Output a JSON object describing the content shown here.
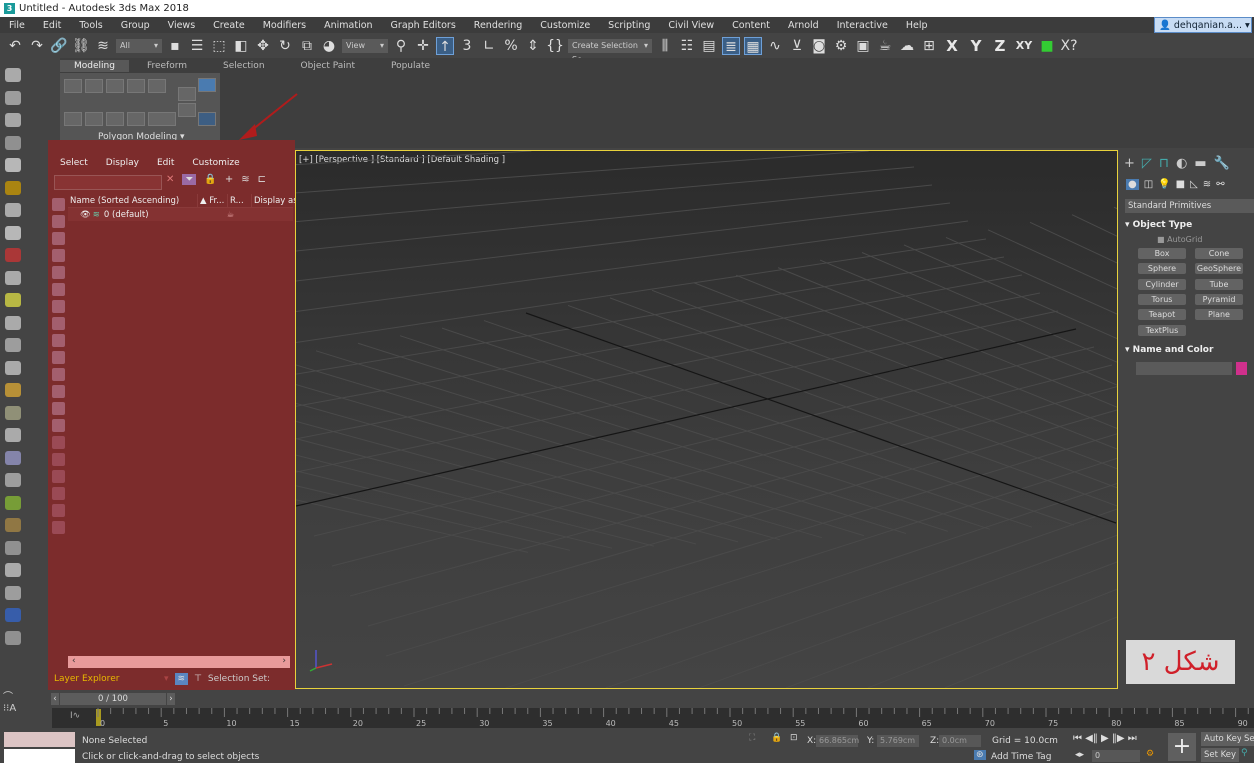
{
  "window": {
    "title": "Untitled - Autodesk 3ds Max 2018",
    "app_icon": "3"
  },
  "menu": [
    "File",
    "Edit",
    "Tools",
    "Group",
    "Views",
    "Create",
    "Modifiers",
    "Animation",
    "Graph Editors",
    "Rendering",
    "Customize",
    "Scripting",
    "Civil View",
    "Content",
    "Arnold",
    "Interactive",
    "Help"
  ],
  "user": {
    "name": "dehqanian.a...",
    "icon": "user-icon"
  },
  "toolbar": {
    "filter": "All",
    "coord": "View",
    "selection_set": "Create Selection Se",
    "axes": [
      "X",
      "Y",
      "Z",
      "XY"
    ]
  },
  "ribbon": {
    "tabs": [
      "Modeling",
      "Freeform",
      "Selection",
      "Object Paint",
      "Populate"
    ],
    "active": "Modeling",
    "panel_label": "Polygon Modeling"
  },
  "explorer": {
    "menu": [
      "Select",
      "Display",
      "Edit",
      "Customize"
    ],
    "columns": [
      "Name (Sorted Ascending)",
      "▲ Fr...",
      "R...",
      "Display as"
    ],
    "rows": [
      {
        "name": "0 (default)"
      }
    ],
    "mode": "Layer Explorer",
    "selection_set": "Selection Set:",
    "overlay_color": "#7c2c2c"
  },
  "viewport": {
    "label": "[+] [Perspective ] [Standard ] [Default Shading ]",
    "border_color": "#e8d23c"
  },
  "command_panel": {
    "category": "Standard Primitives",
    "object_type_title": "Object Type",
    "autogrid": "AutoGrid",
    "buttons": [
      "Box",
      "Cone",
      "Sphere",
      "GeoSphere",
      "Cylinder",
      "Tube",
      "Torus",
      "Pyramid",
      "Teapot",
      "Plane",
      "TextPlus"
    ],
    "name_color_title": "Name and Color",
    "name_value": "",
    "color": "#d0308c"
  },
  "annotation": {
    "text": "شکل ۲"
  },
  "timeline": {
    "frame": "0 / 100",
    "ticks": [
      "0",
      "5",
      "10",
      "15",
      "20",
      "25",
      "30",
      "35",
      "40",
      "45",
      "50",
      "55",
      "60",
      "65",
      "70",
      "75",
      "80",
      "85",
      "90"
    ]
  },
  "status": {
    "selection": "None Selected",
    "prompt": "Click or click-and-drag to select objects",
    "x_label": "X:",
    "x": "66.865cm",
    "y_label": "Y:",
    "y": "5.769cm",
    "z_label": "Z:",
    "z": "0.0cm",
    "grid": "Grid = 10.0cm",
    "add_time_tag": "Add Time Tag",
    "current_frame": "0",
    "auto_key": "Auto Key",
    "set_key": "Set Key",
    "sel": "Sel"
  }
}
